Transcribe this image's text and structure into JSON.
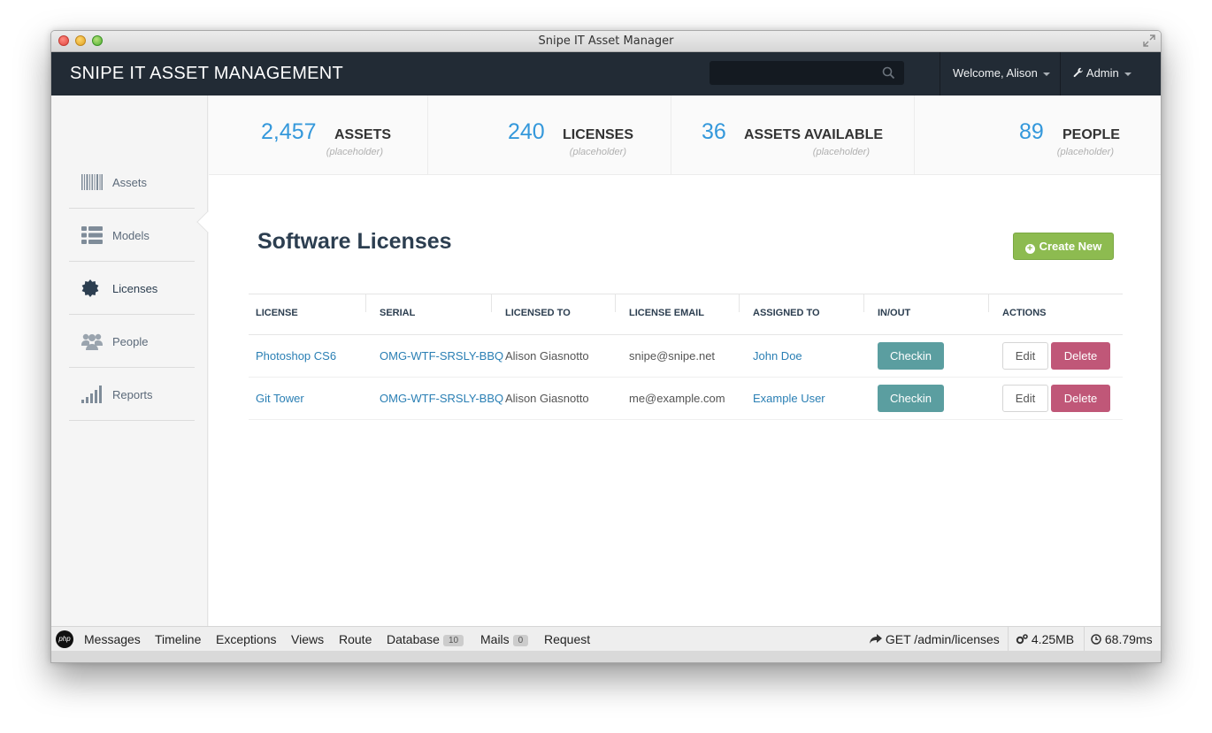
{
  "window": {
    "title": "Snipe IT Asset Manager"
  },
  "navbar": {
    "brand": "SNIPE IT ASSET MANAGEMENT",
    "search_placeholder": "",
    "welcome": "Welcome, Alison",
    "admin": "Admin"
  },
  "sidebar": {
    "items": [
      {
        "label": "Assets",
        "icon": "barcode-icon"
      },
      {
        "label": "Models",
        "icon": "list-icon"
      },
      {
        "label": "Licenses",
        "icon": "certificate-icon",
        "active": true
      },
      {
        "label": "People",
        "icon": "users-icon"
      },
      {
        "label": "Reports",
        "icon": "signal-icon"
      }
    ]
  },
  "stats": [
    {
      "number": "2,457",
      "label": "ASSETS",
      "sub": "(placeholder)"
    },
    {
      "number": "240",
      "label": "LICENSES",
      "sub": "(placeholder)"
    },
    {
      "number": "36",
      "label": "ASSETS AVAILABLE",
      "sub": "(placeholder)"
    },
    {
      "number": "89",
      "label": "PEOPLE",
      "sub": "(placeholder)"
    }
  ],
  "main": {
    "title": "Software Licenses",
    "create_label": "Create New"
  },
  "table": {
    "headers": [
      "LICENSE",
      "SERIAL",
      "LICENSED TO",
      "LICENSE EMAIL",
      "ASSIGNED TO",
      "IN/OUT",
      "ACTIONS"
    ],
    "rows": [
      {
        "license": "Photoshop CS6",
        "serial": "OMG-WTF-SRSLY-BBQ",
        "licensed_to": "Alison Giasnotto",
        "email": "snipe@snipe.net",
        "assigned_to": "John Doe",
        "inout": "Checkin",
        "edit": "Edit",
        "delete": "Delete"
      },
      {
        "license": "Git Tower",
        "serial": "OMG-WTF-SRSLY-BBQ",
        "licensed_to": "Alison Giasnotto",
        "email": "me@example.com",
        "assigned_to": "Example User",
        "inout": "Checkin",
        "edit": "Edit",
        "delete": "Delete"
      }
    ]
  },
  "debugbar": {
    "logo": "php",
    "tabs": [
      "Messages",
      "Timeline",
      "Exceptions",
      "Views",
      "Route",
      "Database",
      "Mails",
      "Request"
    ],
    "database_count": "10",
    "mails_count": "0",
    "route": "GET /admin/licenses",
    "memory": "4.25MB",
    "time": "68.79ms"
  },
  "colors": {
    "navbar": "#222b35",
    "stat_number": "#3498db",
    "link": "#2a7fb4",
    "create_button": "#8dbb50",
    "checkin_button": "#5b9ea0",
    "delete_button": "#c05778"
  }
}
